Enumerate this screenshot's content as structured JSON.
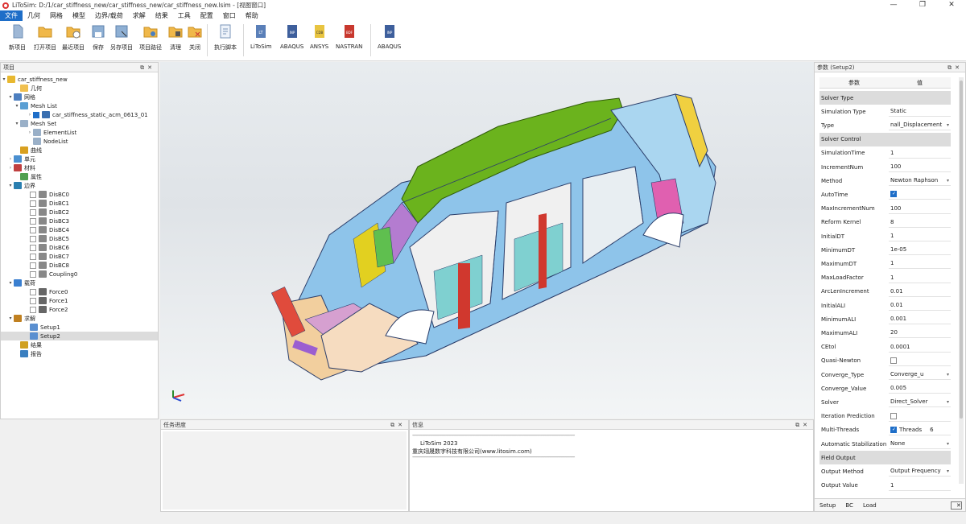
{
  "window": {
    "title": "LiToSim: D:/1/car_stiffness_new/car_stiffness_new/car_stiffness_new.lsim - [视图窗口]",
    "controls": [
      "—",
      "❐",
      "✕"
    ]
  },
  "menu": [
    "文件",
    "几何",
    "网格",
    "模型",
    "边界/载荷",
    "求解",
    "结果",
    "工具",
    "配置",
    "窗口",
    "帮助"
  ],
  "toolbar": {
    "buttons": [
      {
        "label": "新项目",
        "icon": "new-project-icon"
      },
      {
        "label": "打开项目",
        "icon": "open-project-icon"
      },
      {
        "label": "最近项目",
        "icon": "recent-project-icon"
      },
      {
        "label": "保存",
        "icon": "save-icon"
      },
      {
        "label": "另存项目",
        "icon": "save-as-icon"
      },
      {
        "label": "项目路径",
        "icon": "project-path-icon"
      },
      {
        "label": "清理",
        "icon": "clean-icon"
      },
      {
        "label": "关闭",
        "icon": "close-project-icon"
      },
      {
        "label": "执行脚本",
        "icon": "run-script-icon"
      },
      {
        "label": "LiToSim",
        "icon": "litosim-export-icon"
      },
      {
        "label": "ABAQUS",
        "icon": "abaqus-export-icon"
      },
      {
        "label": "ANSYS",
        "icon": "ansys-export-icon"
      },
      {
        "label": "NASTRAN",
        "icon": "nastran-export-icon"
      },
      {
        "label": "ABAQUS",
        "icon": "abaqus-import-icon"
      }
    ]
  },
  "project_panel": {
    "title": "项目",
    "tree": [
      {
        "label": "car_stiffness_new",
        "icon": "project-icon"
      },
      {
        "label": "几何",
        "icon": "geometry-icon"
      },
      {
        "label": "网格",
        "icon": "mesh-icon"
      },
      {
        "label": "Mesh List",
        "icon": "folder-icon"
      },
      {
        "label": "car_stiffness_static_acm_0613_01",
        "icon": "mesh-part-icon"
      },
      {
        "label": "Mesh Set",
        "icon": "folder-icon"
      },
      {
        "label": "ElementList",
        "icon": "list-icon"
      },
      {
        "label": "NodeList",
        "icon": "list-icon"
      },
      {
        "label": "曲线",
        "icon": "curve-icon"
      },
      {
        "label": "单元",
        "icon": "element-icon"
      },
      {
        "label": "材料",
        "icon": "material-icon"
      },
      {
        "label": "属性",
        "icon": "property-icon"
      },
      {
        "label": "边界",
        "icon": "boundary-icon"
      },
      {
        "label": "DisBC0",
        "icon": "bc-icon"
      },
      {
        "label": "DisBC1",
        "icon": "bc-icon"
      },
      {
        "label": "DisBC2",
        "icon": "bc-icon"
      },
      {
        "label": "DisBC3",
        "icon": "bc-icon"
      },
      {
        "label": "DisBC4",
        "icon": "bc-icon"
      },
      {
        "label": "DisBC5",
        "icon": "bc-icon"
      },
      {
        "label": "DisBC6",
        "icon": "bc-icon"
      },
      {
        "label": "DisBC7",
        "icon": "bc-icon"
      },
      {
        "label": "DisBC8",
        "icon": "bc-icon"
      },
      {
        "label": "Coupling0",
        "icon": "bc-icon"
      },
      {
        "label": "载荷",
        "icon": "load-icon"
      },
      {
        "label": "Force0",
        "icon": "force-icon"
      },
      {
        "label": "Force1",
        "icon": "force-icon"
      },
      {
        "label": "Force2",
        "icon": "force-icon"
      },
      {
        "label": "求解",
        "icon": "solve-icon"
      },
      {
        "label": "Setup1",
        "icon": "setup-icon"
      },
      {
        "label": "Setup2",
        "icon": "setup-icon"
      },
      {
        "label": "结果",
        "icon": "result-icon"
      },
      {
        "label": "报告",
        "icon": "report-icon"
      }
    ]
  },
  "task_panel": {
    "title": "任务进度"
  },
  "info_panel": {
    "title": "信息",
    "separator": "------------------------------------------------------------------------------------------------------------------------------------",
    "lines": [
      "LiToSim 2023",
      "重庆翊晟数字科技有限公司(www.litosim.com)"
    ]
  },
  "props_panel": {
    "title": "参数 (Setup2)",
    "col_key": "参数",
    "col_val": "值",
    "rows": [
      {
        "k": "Solver Type",
        "section": true
      },
      {
        "k": "Simulation Type",
        "v": "Static"
      },
      {
        "k": "Type",
        "v": "nall_Displacement",
        "dd": true
      },
      {
        "k": "Solver Control",
        "section": true
      },
      {
        "k": "SimulationTime",
        "v": "1"
      },
      {
        "k": "IncrementNum",
        "v": "100"
      },
      {
        "k": "Method",
        "v": "Newton Raphson",
        "dd": true
      },
      {
        "k": "AutoTime",
        "chk": true
      },
      {
        "k": "MaxIncrementNum",
        "v": "100"
      },
      {
        "k": "Reform Kernel",
        "v": "8"
      },
      {
        "k": "InitialDT",
        "v": "1"
      },
      {
        "k": "MinimumDT",
        "v": "1e-05"
      },
      {
        "k": "MaximumDT",
        "v": "1"
      },
      {
        "k": "MaxLoadFactor",
        "v": "1"
      },
      {
        "k": "ArcLenIncrement",
        "v": "0.01"
      },
      {
        "k": "InitialALI",
        "v": "0.01"
      },
      {
        "k": "MinimumALI",
        "v": "0.001"
      },
      {
        "k": "MaximumALI",
        "v": "20"
      },
      {
        "k": "CEtol",
        "v": "0.0001"
      },
      {
        "k": "Quasi-Newton",
        "chk": false
      },
      {
        "k": "Converge_Type",
        "v": "Converge_u",
        "dd": true
      },
      {
        "k": "Converge_Value",
        "v": "0.005"
      },
      {
        "k": "Solver",
        "v": "Direct_Solver",
        "dd": true
      },
      {
        "k": "Iteration Prediction",
        "chk": false
      },
      {
        "k": "Multi-Threads",
        "chk": true,
        "extra": "Threads",
        "extra_val": "6"
      },
      {
        "k": "Automatic Stabilization",
        "v": "None",
        "dd": true
      },
      {
        "k": "Field Output",
        "section": true
      },
      {
        "k": "Output Method",
        "v": "Output Frequency",
        "dd": true
      },
      {
        "k": "Output Value",
        "v": "1"
      }
    ],
    "tabs": [
      "Setup",
      "BC",
      "Load"
    ]
  },
  "colors": {
    "accent": "#1e6ec8",
    "roof": "#6bb31d",
    "body_blue": "#8ec4ea",
    "panel_cyan": "#7fd0d0"
  }
}
